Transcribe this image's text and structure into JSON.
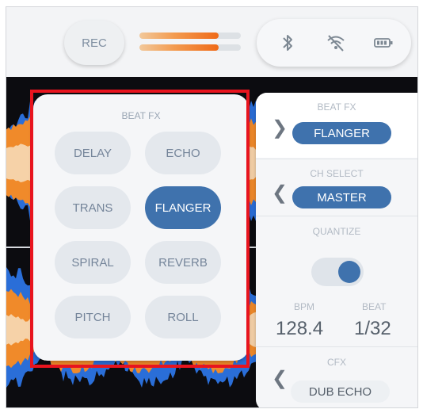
{
  "header": {
    "rec_label": "REC",
    "level_meters": [
      0.78,
      0.78
    ],
    "icons": [
      "bluetooth-icon",
      "wifi-off-icon",
      "battery-icon"
    ]
  },
  "beat_fx_panel": {
    "title": "BEAT FX",
    "effects": [
      {
        "label": "DELAY",
        "active": false
      },
      {
        "label": "ECHO",
        "active": false
      },
      {
        "label": "TRANS",
        "active": false
      },
      {
        "label": "FLANGER",
        "active": true
      },
      {
        "label": "SPIRAL",
        "active": false
      },
      {
        "label": "REVERB",
        "active": false
      },
      {
        "label": "PITCH",
        "active": false
      },
      {
        "label": "ROLL",
        "active": false
      }
    ]
  },
  "side_panel": {
    "beat_fx": {
      "title": "BEAT FX",
      "value": "FLANGER"
    },
    "ch_select": {
      "title": "CH SELECT",
      "value": "MASTER"
    },
    "quantize": {
      "title": "QUANTIZE",
      "enabled": true
    },
    "bpm": {
      "label": "BPM",
      "value": "128.4"
    },
    "beat": {
      "label": "BEAT",
      "value": "1/32"
    },
    "cfx": {
      "title": "CFX",
      "value": "DUB ECHO"
    }
  },
  "colors": {
    "accent": "#3f72ad",
    "meter_orange": "#ef6a18",
    "wave_orange": "#f08a2a",
    "wave_blue": "#2a6ed8",
    "highlight": "#e8141e"
  }
}
